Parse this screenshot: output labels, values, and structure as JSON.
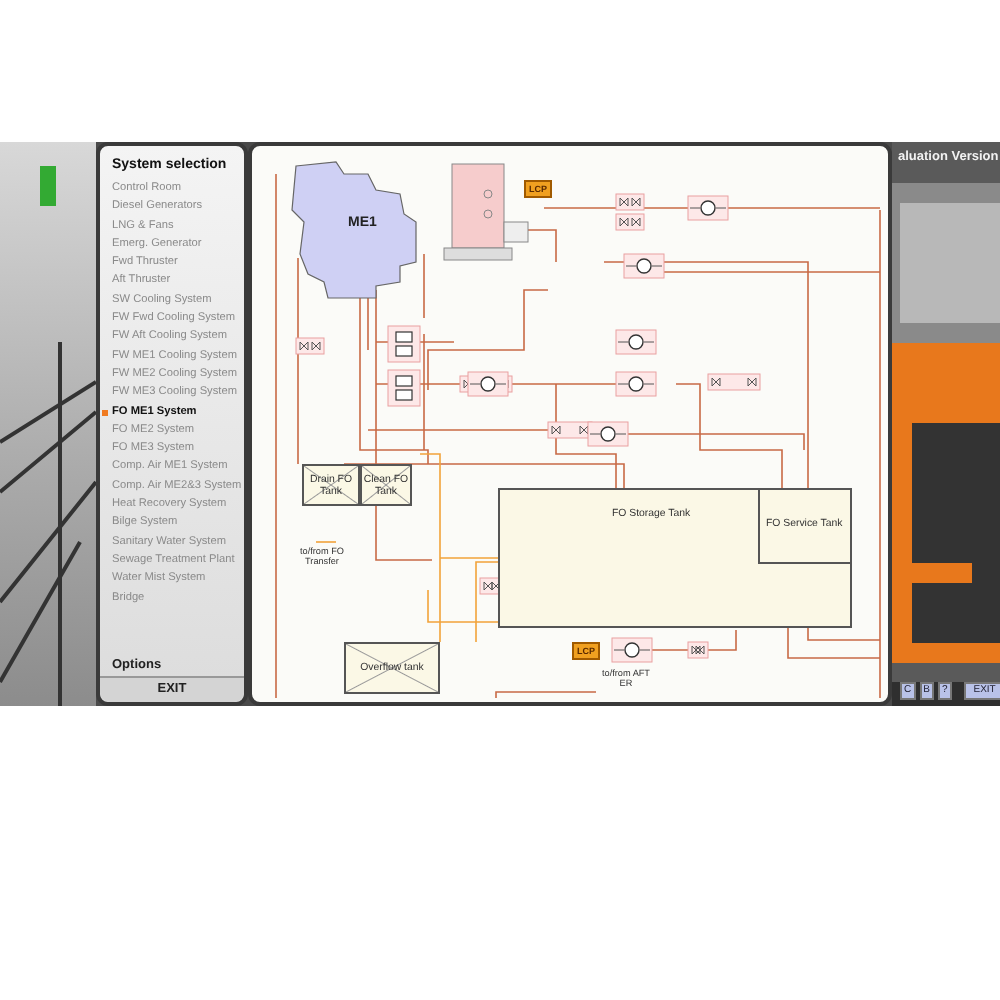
{
  "sidebar": {
    "title": "System selection",
    "items": [
      {
        "label": "Control Room",
        "selected": false
      },
      {
        "label": "Diesel Generators",
        "selected": false
      },
      {
        "label": "LNG & Fans",
        "selected": false
      },
      {
        "label": "Emerg. Generator",
        "selected": false
      },
      {
        "label": "Fwd Thruster",
        "selected": false
      },
      {
        "label": "Aft Thruster",
        "selected": false
      },
      {
        "label": "SW Cooling System",
        "selected": false
      },
      {
        "label": "FW Fwd Cooling System",
        "selected": false
      },
      {
        "label": "FW Aft Cooling System",
        "selected": false
      },
      {
        "label": "FW ME1 Cooling System",
        "selected": false
      },
      {
        "label": "FW ME2 Cooling System",
        "selected": false
      },
      {
        "label": "FW ME3 Cooling System",
        "selected": false
      },
      {
        "label": "FO ME1 System",
        "selected": true
      },
      {
        "label": "FO ME2 System",
        "selected": false
      },
      {
        "label": "FO ME3 System",
        "selected": false
      },
      {
        "label": "Comp. Air ME1 System",
        "selected": false
      },
      {
        "label": "Comp. Air ME2&3 System",
        "selected": false
      },
      {
        "label": "Heat Recovery System",
        "selected": false
      },
      {
        "label": "Bilge System",
        "selected": false
      },
      {
        "label": "Sanitary Water System",
        "selected": false
      },
      {
        "label": "Sewage Treatment Plant",
        "selected": false
      },
      {
        "label": "Water Mist System",
        "selected": false
      },
      {
        "label": "Bridge",
        "selected": false
      }
    ],
    "options": "Options",
    "exit": "EXIT"
  },
  "diagram": {
    "engine": "ME1",
    "lcp_badges": [
      "LCP",
      "LCP"
    ],
    "tanks": [
      {
        "label": "Drain FO Tank"
      },
      {
        "label": "Clean FO Tank"
      },
      {
        "label": "Overflow tank"
      },
      {
        "label": "FO Storage Tank"
      },
      {
        "label": "FO Service Tank"
      }
    ],
    "notes": [
      "to/from FO Transfer",
      "to/from AFT ER"
    ]
  },
  "banner": "aluation Version",
  "controls": {
    "buttons": [
      "C",
      "B",
      "?"
    ],
    "exit": "EXIT"
  }
}
